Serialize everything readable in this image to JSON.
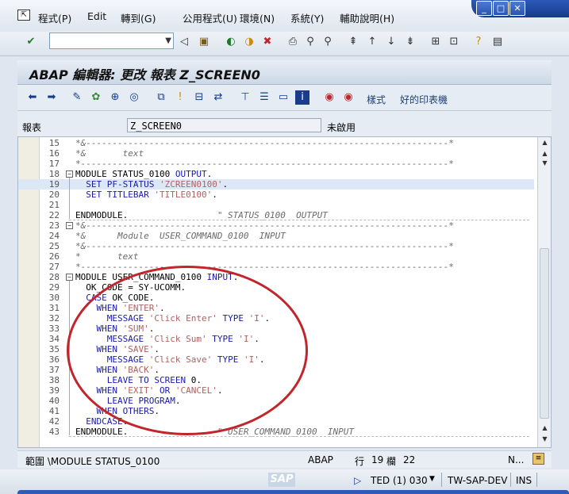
{
  "menu": [
    "程式(P)",
    "Edit",
    "轉到(G)",
    "公用程式(U)",
    "環境(N)",
    "系統(Y)",
    "輔助說明(H)"
  ],
  "title": "ABAP 編輯器: 更改 報表 Z_SCREEN0",
  "appbar": {
    "style_label": "樣式",
    "pretty_printer_label": "好的印表機"
  },
  "report": {
    "label": "報表",
    "value": "Z_SCREEN0",
    "status": "未啟用"
  },
  "code_lines": [
    {
      "n": "15",
      "t": "*&---------------------------------------------------------------------*"
    },
    {
      "n": "16",
      "t": "*&       text"
    },
    {
      "n": "17",
      "t": "*----------------------------------------------------------------------*"
    },
    {
      "n": "18",
      "t": "MODULE STATUS_0100 OUTPUT."
    },
    {
      "n": "19",
      "t": "  SET PF-STATUS 'ZCREEN0100'."
    },
    {
      "n": "20",
      "t": "  SET TITLEBAR 'TITLE0100'."
    },
    {
      "n": "21",
      "t": ""
    },
    {
      "n": "22",
      "t": "ENDMODULE.                 \" STATUS_0100  OUTPUT"
    },
    {
      "n": "23",
      "t": "*&---------------------------------------------------------------------*"
    },
    {
      "n": "24",
      "t": "*&      Module  USER_COMMAND_0100  INPUT"
    },
    {
      "n": "25",
      "t": "*&---------------------------------------------------------------------*"
    },
    {
      "n": "26",
      "t": "*       text"
    },
    {
      "n": "27",
      "t": "*----------------------------------------------------------------------*"
    },
    {
      "n": "28",
      "t": "MODULE USER_COMMAND_0100 INPUT."
    },
    {
      "n": "29",
      "t": "  OK_CODE = SY-UCOMM."
    },
    {
      "n": "30",
      "t": "  CASE OK_CODE."
    },
    {
      "n": "31",
      "t": "    WHEN 'ENTER'."
    },
    {
      "n": "32",
      "t": "      MESSAGE 'Click Enter' TYPE 'I'."
    },
    {
      "n": "33",
      "t": "    WHEN 'SUM'."
    },
    {
      "n": "34",
      "t": "      MESSAGE 'Click Sum' TYPE 'I'."
    },
    {
      "n": "35",
      "t": "    WHEN 'SAVE'."
    },
    {
      "n": "36",
      "t": "      MESSAGE 'Click Save' TYPE 'I'."
    },
    {
      "n": "37",
      "t": "    WHEN 'BACK'."
    },
    {
      "n": "38",
      "t": "      LEAVE TO SCREEN 0."
    },
    {
      "n": "39",
      "t": "    WHEN 'EXIT' OR 'CANCEL'."
    },
    {
      "n": "40",
      "t": "      LEAVE PROGRAM."
    },
    {
      "n": "41",
      "t": "    WHEN OTHERS."
    },
    {
      "n": "42",
      "t": "  ENDCASE."
    },
    {
      "n": "43",
      "t": "ENDMODULE.                 \" USER_COMMAND_0100  INPUT"
    }
  ],
  "status_line": {
    "scope": "範圍 \\MODULE STATUS_0100",
    "lang": "ABAP",
    "row_label": "行",
    "row": "19",
    "col_label": "欄",
    "col": "22",
    "mode": "N..."
  },
  "statusbar": {
    "sap": "SAP",
    "system": "TED (1) 030",
    "server": "TW-SAP-DEV",
    "ins": "INS"
  },
  "colors": {
    "keyword": "#1a1aa6",
    "string": "#b06060",
    "comment": "#6b6b6b",
    "annotation": "#c0262c"
  }
}
